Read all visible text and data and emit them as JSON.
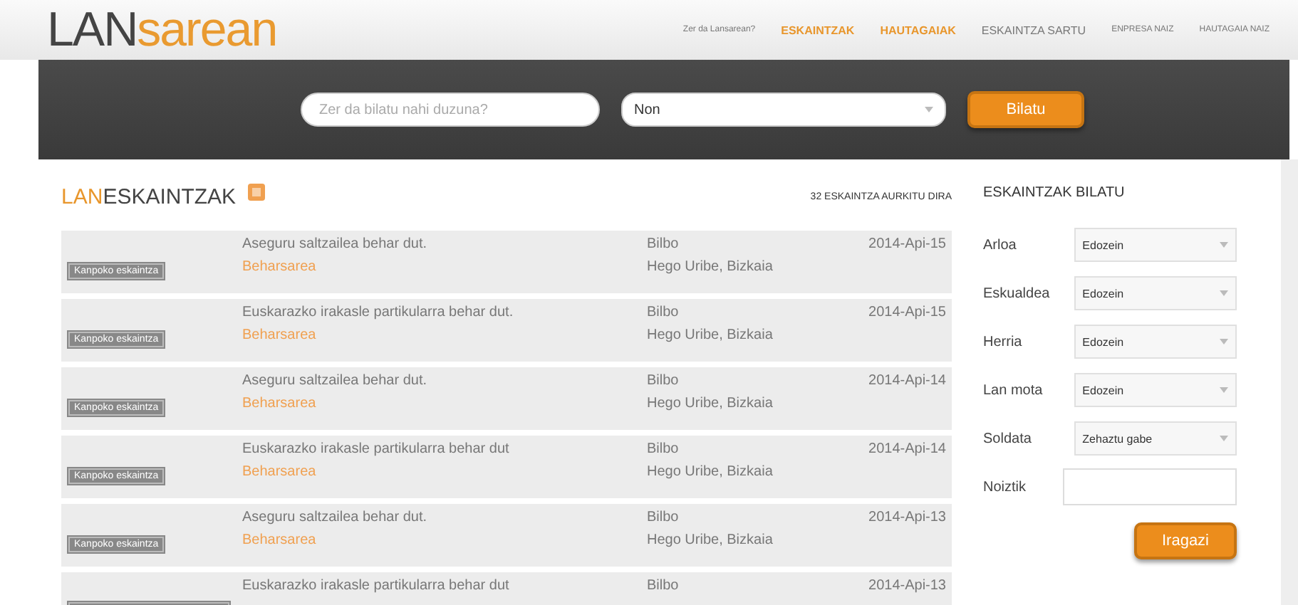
{
  "logo": {
    "part_1": "LAN",
    "part_2": "sarean"
  },
  "nav": [
    {
      "label": "Zer da Lansarean?",
      "highlighted": false,
      "small": true
    },
    {
      "label": "ESKAINTZAK",
      "highlighted": true,
      "small": false
    },
    {
      "label": "HAUTAGAIAK",
      "highlighted": true,
      "small": false
    },
    {
      "label": "ESKAINTZA SARTU",
      "highlighted": false,
      "small": false
    },
    {
      "label": "ENPRESA NAIZ",
      "highlighted": false,
      "small": true
    },
    {
      "label": "HAUTAGAIA NAIZ",
      "highlighted": false,
      "small": true
    }
  ],
  "search": {
    "placeholder": "Zer da bilatu nahi duzuna?",
    "location": "Non",
    "button": "Bilatu"
  },
  "listing": {
    "title_1": "LAN",
    "title_2": "ESKAINTZAK",
    "count": "32 ESKAINTZA AURKITU DIRA",
    "rows": [
      {
        "badge": "Kanpoko eskaintza",
        "title": "Aseguru saltzailea behar dut.",
        "source": "Beharsarea",
        "city": "Bilbo",
        "region": "Hego Uribe, Bizkaia",
        "date": "2014-Api-15"
      },
      {
        "badge": "Kanpoko eskaintza",
        "title": "Euskarazko irakasle partikularra behar dut.",
        "source": "Beharsarea",
        "city": "Bilbo",
        "region": "Hego Uribe, Bizkaia",
        "date": "2014-Api-15"
      },
      {
        "badge": "Kanpoko eskaintza",
        "title": "Aseguru saltzailea behar dut.",
        "source": "Beharsarea",
        "city": "Bilbo",
        "region": "Hego Uribe, Bizkaia",
        "date": "2014-Api-14"
      },
      {
        "badge": "Kanpoko eskaintza",
        "title": "Euskarazko irakasle partikularra behar dut",
        "source": "Beharsarea",
        "city": "Bilbo",
        "region": "Hego Uribe, Bizkaia",
        "date": "2014-Api-14"
      },
      {
        "badge": "Kanpoko eskaintza",
        "title": "Aseguru saltzailea behar dut.",
        "source": "Beharsarea",
        "city": "Bilbo",
        "region": "Hego Uribe, Bizkaia",
        "date": "2014-Api-13"
      },
      {
        "title": "Euskarazko irakasle partikularra behar dut",
        "city": "Bilbo",
        "date": "2014-Api-13"
      }
    ]
  },
  "filters": {
    "title": "ESKAINTZAK BILATU",
    "button": "Iragazi",
    "fields": [
      {
        "kind": "select",
        "label": "Arloa",
        "value": "Edozein"
      },
      {
        "kind": "select",
        "label": "Eskualdea",
        "value": "Edozein"
      },
      {
        "kind": "select",
        "label": "Herria",
        "value": "Edozein"
      },
      {
        "kind": "select",
        "label": "Lan mota",
        "value": "Edozein"
      },
      {
        "kind": "select",
        "label": "Soldata",
        "value": "Zehaztu gabe"
      },
      {
        "kind": "text",
        "label": "Noiztik"
      }
    ]
  }
}
